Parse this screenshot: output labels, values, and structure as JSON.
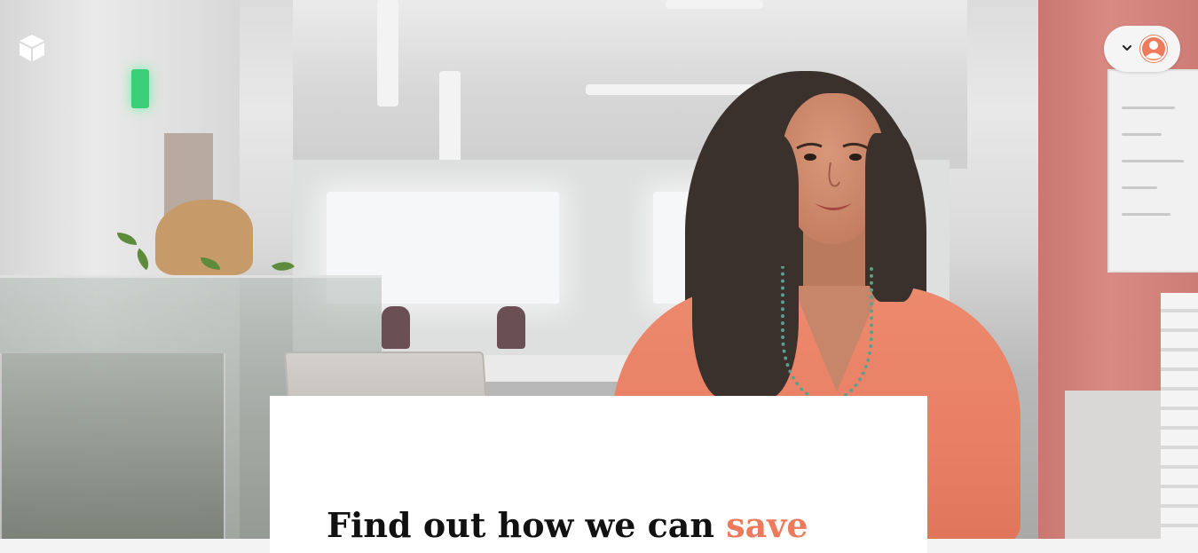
{
  "header": {
    "logo_icon": "cube-icon",
    "account_menu": {
      "dropdown_icon": "chevron-down-icon",
      "avatar_icon": "user-avatar-icon"
    }
  },
  "hero": {
    "image_alt": "Woman in coral sweater standing in an office"
  },
  "card": {
    "headline_part1": "Find out how we can ",
    "headline_accent": "save"
  },
  "colors": {
    "accent": "#ec7b5d",
    "headline": "#111111",
    "card_background": "#ffffff",
    "pill_background": "#f5f5f5"
  }
}
